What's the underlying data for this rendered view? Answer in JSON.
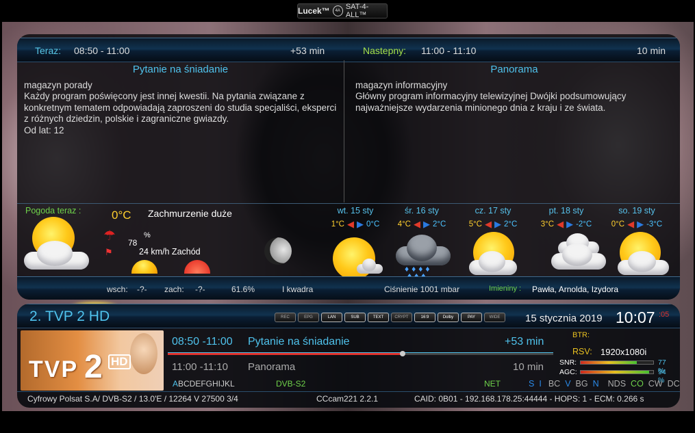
{
  "brand": {
    "name": "Lucek™",
    "logo": "SAT-4-ALL™",
    "badge": "4A"
  },
  "epg": {
    "now_label": "Teraz:",
    "now_time": "08:50 - 11:00",
    "now_remaining": "+53 min",
    "next_label": "Nastepny:",
    "next_time": "11:00 - 11:10",
    "next_duration": "10 min",
    "current": {
      "title": "Pytanie na śniadanie",
      "genre": "magazyn porady",
      "description": "Każdy program poświęcony jest innej kwestii. Na pytania związane z konkretnym tematem odpowiadają zaproszeni do studia specjaliści, eksperci z różnych dziedzin, polskie i zagraniczne gwiazdy.",
      "age": "Od lat: 12"
    },
    "next": {
      "title": "Panorama",
      "genre": "magazyn informacyjny",
      "description": "Główny program informacyjny telewizyjnej Dwójki podsumowujący najważniejsze wydarzenia minionego dnia z kraju i ze świata."
    }
  },
  "weather": {
    "now_label": "Pogoda teraz :",
    "temp": "0°C",
    "condition": "Zachmurzenie duże",
    "humidity": "78",
    "humidity_unit": "%",
    "wind": "24 km/h Zachód",
    "forecast": [
      {
        "day": "wt. 15 sty",
        "max": "1°C",
        "min": "0°C",
        "icon": "sun-cloud-icon"
      },
      {
        "day": "śr. 16 sty",
        "max": "4°C",
        "min": "2°C",
        "icon": "rain-cloud-icon"
      },
      {
        "day": "cz. 17 sty",
        "max": "5°C",
        "min": "2°C",
        "icon": "sun-cloud-icon"
      },
      {
        "day": "pt. 18 sty",
        "max": "3°C",
        "min": "-2°C",
        "icon": "cloud-icon"
      },
      {
        "day": "so. 19 sty",
        "max": "0°C",
        "min": "-3°C",
        "icon": "sun-cloud-icon"
      }
    ],
    "sunrise_label": "wsch:",
    "sunrise": "-?-",
    "sunset_label": "zach:",
    "sunset": "-?-",
    "moon_pct": "61.6%",
    "moon_phase": "I kwadra",
    "pressure": "Ciśnienie  1001 mbar",
    "names_label": "Imieniny :",
    "names": "Pawła, Arnolda, Izydora"
  },
  "channel": {
    "name": "2. TVP 2 HD",
    "logo_tvp": "TVP",
    "logo_two": "2",
    "logo_hd": "HD",
    "date": "15 stycznia 2019",
    "time": "10:07",
    "seconds": ":05",
    "icons": [
      "REC",
      "EPG",
      "LAN",
      "SUB",
      "TEXT",
      "CRYPT",
      "16:9",
      "Dolby",
      "PAY",
      "WIDE"
    ],
    "now_time": "08:50 -11:00",
    "now_title": "Pytanie na śniadanie",
    "now_remaining": "+53 min",
    "progress": 0.61,
    "next_time": "11:00 -11:10",
    "next_title": "Panorama",
    "next_duration": "10 min",
    "alpha_first": "A",
    "alpha_rest": "BCDEFGHIJKL",
    "delivery": "DVB-S2",
    "net": "NET",
    "flags": [
      "S",
      "I",
      "BC",
      "V",
      "BG",
      "N",
      "NDS",
      "CO",
      "CW",
      "DC"
    ],
    "btr_label": "BTR:",
    "rsv_label": "RSV:",
    "resolution": "1920x1080i",
    "snr_label": "SNR:",
    "snr": "77 %",
    "snr_val": 0.77,
    "agc_label": "AGC:",
    "agc": "94 %",
    "agc_val": 0.94
  },
  "status": {
    "transponder": "Cyfrowy Polsat S.A/ DVB-S2 /  13.0'E  /  12264  V  27500  3/4",
    "softcam": "CCcam221 2.2.1",
    "ecm": "CAID: 0B01 - 192.168.178.25:44444 - HOPS: 1 - ECM: 0.266 s"
  },
  "colors": {
    "accent": "#4fc2ec",
    "next": "#a6e04a",
    "alert": "#e0302a"
  }
}
